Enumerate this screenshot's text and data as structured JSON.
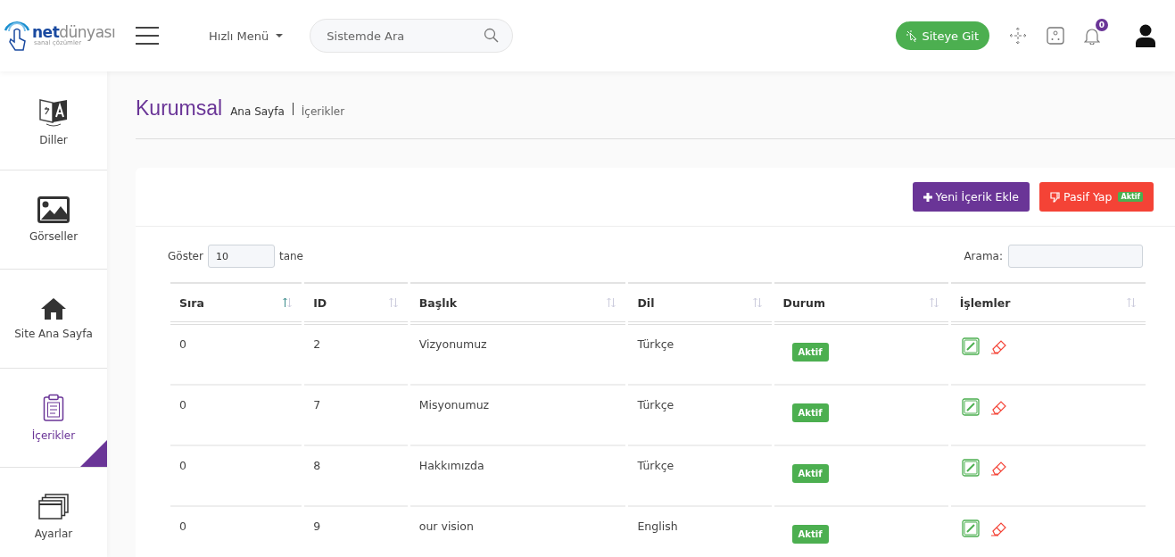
{
  "header": {
    "logo": {
      "strong": "net",
      "rest": "dünyası",
      "tagline": "sanal çözümler"
    },
    "quick_menu": "Hızlı Menü",
    "search": {
      "placeholder": "Sistemde Ara"
    },
    "site_button": "Siteye Git",
    "notifications": {
      "count": "0"
    }
  },
  "sidebar": {
    "items": [
      {
        "label": "Diller",
        "selected": false
      },
      {
        "label": "Görseller",
        "selected": false
      },
      {
        "label": "Site Ana Sayfa",
        "selected": false
      },
      {
        "label": "İçerikler",
        "selected": true
      },
      {
        "label": "Ayarlar",
        "selected": false
      }
    ]
  },
  "page": {
    "title": "Kurumsal",
    "breadcrumb": [
      "Ana Sayfa",
      "İçerikler"
    ]
  },
  "toolbar": {
    "add_button": "Yeni İçerik Ekle",
    "deactivate_button": {
      "label": "Pasif Yap",
      "badge": "Aktif"
    }
  },
  "table_controls": {
    "show_label": "Göster",
    "page_size": "10",
    "show_suffix": "tane",
    "search_label": "Arama:"
  },
  "table": {
    "columns": [
      {
        "label": "Sıra",
        "sorted": true
      },
      {
        "label": "ID",
        "sorted": false
      },
      {
        "label": "Başlık",
        "sorted": false
      },
      {
        "label": "Dil",
        "sorted": false
      },
      {
        "label": "Durum",
        "sorted": false
      },
      {
        "label": "İşlemler",
        "sorted": false
      }
    ],
    "rows": [
      {
        "order": "0",
        "id": "2",
        "title": "Vizyonumuz",
        "language": "Türkçe",
        "status": "Aktif"
      },
      {
        "order": "0",
        "id": "7",
        "title": "Misyonumuz",
        "language": "Türkçe",
        "status": "Aktif"
      },
      {
        "order": "0",
        "id": "8",
        "title": "Hakkımızda",
        "language": "Türkçe",
        "status": "Aktif"
      },
      {
        "order": "0",
        "id": "9",
        "title": "our vision",
        "language": "English",
        "status": "Aktif"
      }
    ]
  }
}
